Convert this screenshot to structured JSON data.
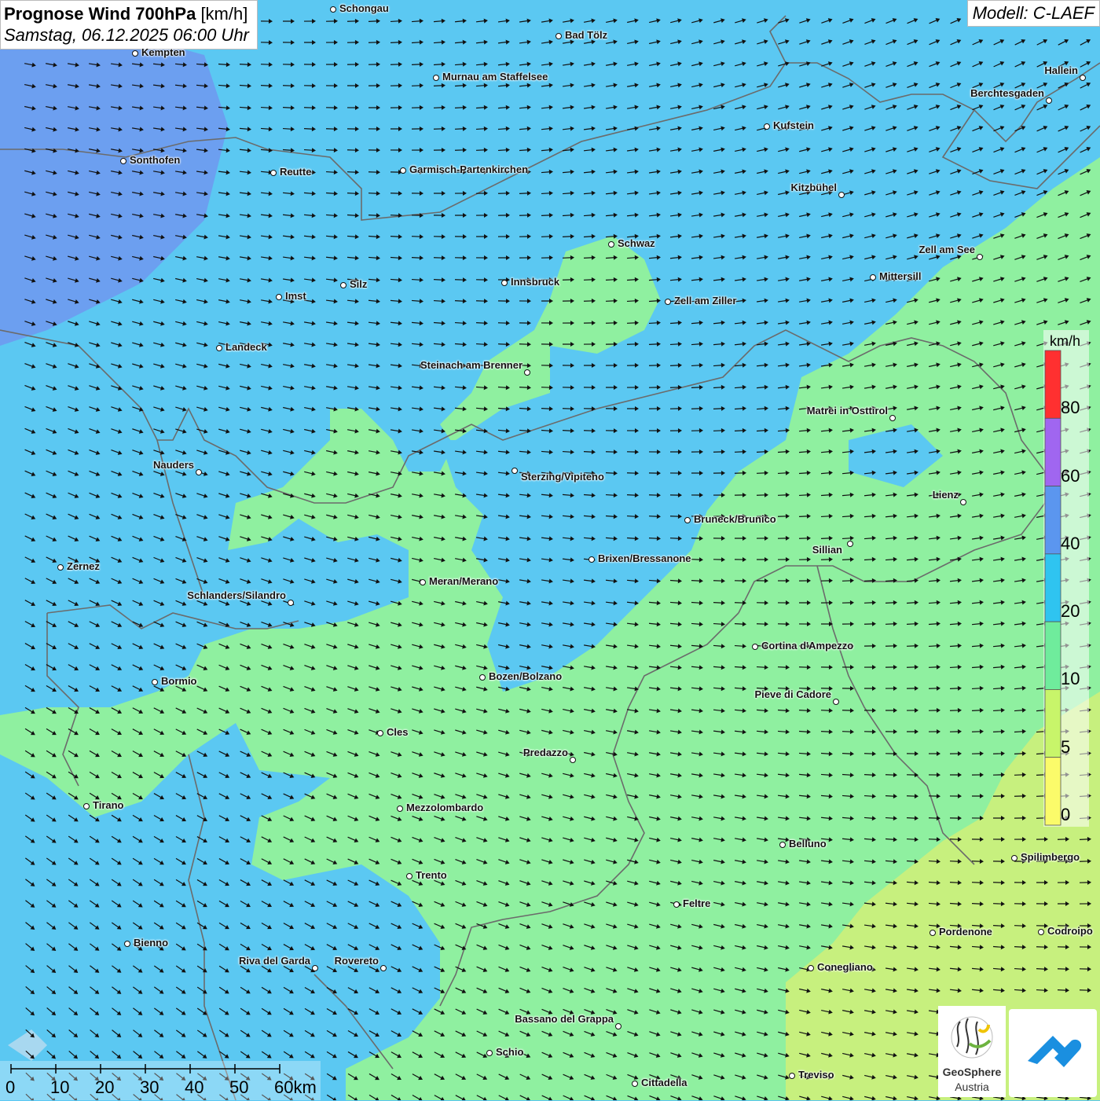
{
  "title": {
    "main": "Prognose Wind 700hPa",
    "unit": "[km/h]",
    "date": "Samstag, 06.12.2025 06:00 Uhr"
  },
  "model": "Modell: C-LAEF",
  "legend": {
    "unit": "km/h",
    "ticks": [
      "80",
      "60",
      "40",
      "20",
      "10",
      "5",
      "0"
    ],
    "colors": [
      "#ff3030",
      "#a066f0",
      "#5b96ef",
      "#2fc4f0",
      "#6fec9c",
      "#c8f56a",
      "#fbfb6a"
    ]
  },
  "scalebar": [
    "0",
    "10",
    "20",
    "30",
    "40",
    "50",
    "60km"
  ],
  "logos": {
    "geosphere_name": "GeoSphere",
    "geosphere_sub": "Austria"
  },
  "cities": [
    {
      "name": "Schongau"
    },
    {
      "name": "Bad Tölz"
    },
    {
      "name": "Kempten"
    },
    {
      "name": "Murnau am Staffelsee"
    },
    {
      "name": "Hallein"
    },
    {
      "name": "Berchtesgaden"
    },
    {
      "name": "Kufstein"
    },
    {
      "name": "Sonthofen"
    },
    {
      "name": "Reutte"
    },
    {
      "name": "Garmisch-Partenkirchen"
    },
    {
      "name": "Kitzbühel"
    },
    {
      "name": "Schwaz"
    },
    {
      "name": "Zell am See"
    },
    {
      "name": "Mittersill"
    },
    {
      "name": "Innsbruck"
    },
    {
      "name": "Silz"
    },
    {
      "name": "Imst"
    },
    {
      "name": "Zell am Ziller"
    },
    {
      "name": "Landeck"
    },
    {
      "name": "Steinach am Brenner"
    },
    {
      "name": "Matrei in Osttirol"
    },
    {
      "name": "Nauders"
    },
    {
      "name": "Sterzing/Vipiteno"
    },
    {
      "name": "Lienz"
    },
    {
      "name": "Bruneck/Brunico"
    },
    {
      "name": "Sillian"
    },
    {
      "name": "Brixen/Bressanone"
    },
    {
      "name": "Zernez"
    },
    {
      "name": "Meran/Merano"
    },
    {
      "name": "Schlanders/Silandro"
    },
    {
      "name": "Cortina d'Ampezzo"
    },
    {
      "name": "Bozen/Bolzano"
    },
    {
      "name": "Bormio"
    },
    {
      "name": "Pieve di Cadore"
    },
    {
      "name": "Cles"
    },
    {
      "name": "Predazzo"
    },
    {
      "name": "Tirano"
    },
    {
      "name": "Mezzolombardo"
    },
    {
      "name": "Belluno"
    },
    {
      "name": "Spilimbergo"
    },
    {
      "name": "Trento"
    },
    {
      "name": "Feltre"
    },
    {
      "name": "Pordenone"
    },
    {
      "name": "Codroipo"
    },
    {
      "name": "Bienno"
    },
    {
      "name": "Riva del Garda"
    },
    {
      "name": "Rovereto"
    },
    {
      "name": "Conegliano"
    },
    {
      "name": "Bassano del Grappa"
    },
    {
      "name": "Schio"
    },
    {
      "name": "Treviso"
    },
    {
      "name": "Cittadella"
    }
  ]
}
